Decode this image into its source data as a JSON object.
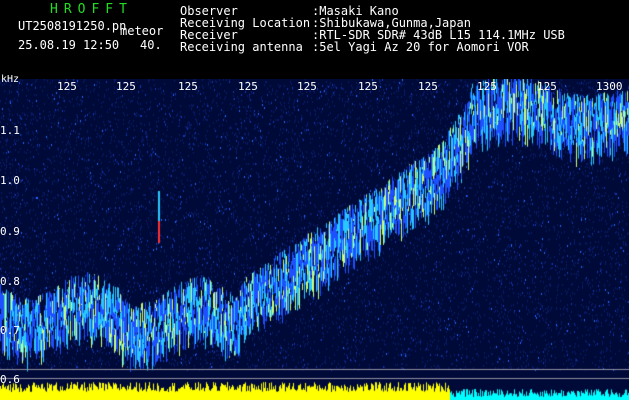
{
  "header": {
    "app_title": "HROFFT",
    "filename": "UT2508191250.pn",
    "tag": "meteor",
    "datetime": "25.08.19 12:50",
    "level": "40.",
    "info": [
      {
        "label": "Observer",
        "value": ":Masaki Kano"
      },
      {
        "label": "Receiving Location",
        "value": ":Shibukawa,Gunma,Japan"
      },
      {
        "label": "Receiver",
        "value": ":RTL-SDR SDR# 43dB L15 114.1MHz USB"
      },
      {
        "label": "Receiving antenna",
        "value": ":5el Yagi Az 20 for Aomori VOR"
      }
    ]
  },
  "spectrogram": {
    "y_unit": "kHz",
    "y_ticks": [
      "1.1",
      "1.0",
      "0.9",
      "0.8",
      "0.7",
      "0.6"
    ],
    "x_ticks": [
      "125",
      "125",
      "125",
      "125",
      "125",
      "125",
      "125",
      "125",
      "125",
      "1300"
    ],
    "colors": {
      "background": "#000a38",
      "signal_low": "#1e50ff",
      "signal_mid": "#28c8ff",
      "signal_high": "#c8ff80",
      "meteor": "#ff3030",
      "level_bar": "#ffff00",
      "level_bar_tail": "#00ffff",
      "grid": "#9090a0"
    }
  }
}
